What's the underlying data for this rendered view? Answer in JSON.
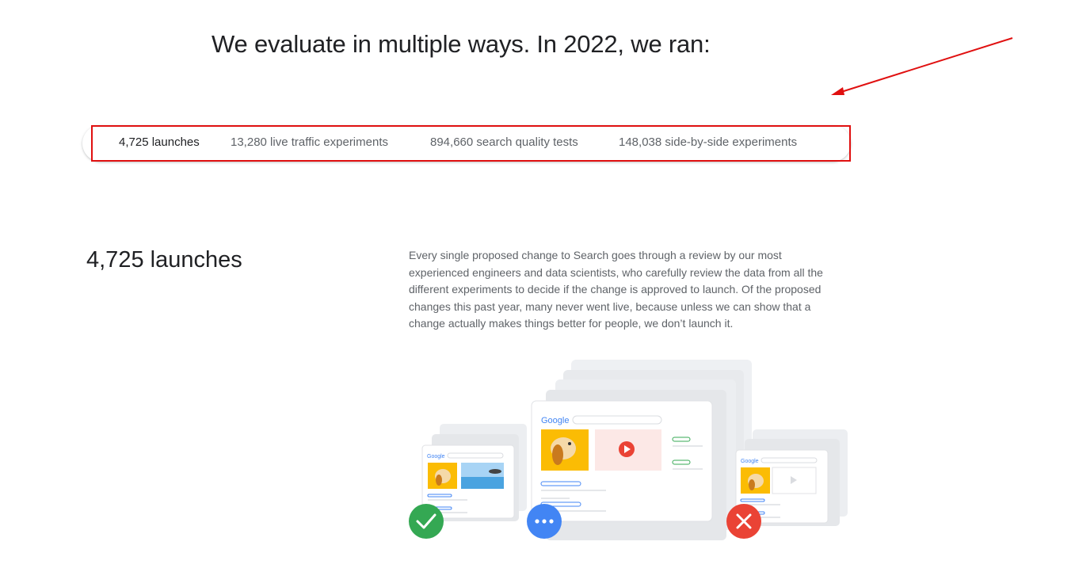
{
  "page": {
    "headline": "We evaluate in multiple ways. In 2022, we ran:"
  },
  "tabs": [
    {
      "label": "4,725 launches",
      "active": true
    },
    {
      "label": "13,280 live traffic experiments",
      "active": false
    },
    {
      "label": "894,660 search quality tests",
      "active": false
    },
    {
      "label": "148,038 side-by-side experiments",
      "active": false
    }
  ],
  "section": {
    "title": "4,725 launches",
    "body": "Every single proposed change to Search goes through a review by our most experienced engineers and data scientists, who carefully review the data from all the different experiments to decide if the change is approved to launch. Of the proposed changes this past year, many never went live, because unless we can show that a change actually makes things better for people, we don’t launch it."
  },
  "illustration": {
    "brand_text": "Google",
    "icons": [
      "checkmark-icon",
      "more-dots-icon",
      "close-icon",
      "play-icon"
    ],
    "status_colors": {
      "approved": "#34a853",
      "pending": "#4285f4",
      "rejected": "#ea4335"
    }
  },
  "annotation": {
    "color": "#e01010"
  }
}
